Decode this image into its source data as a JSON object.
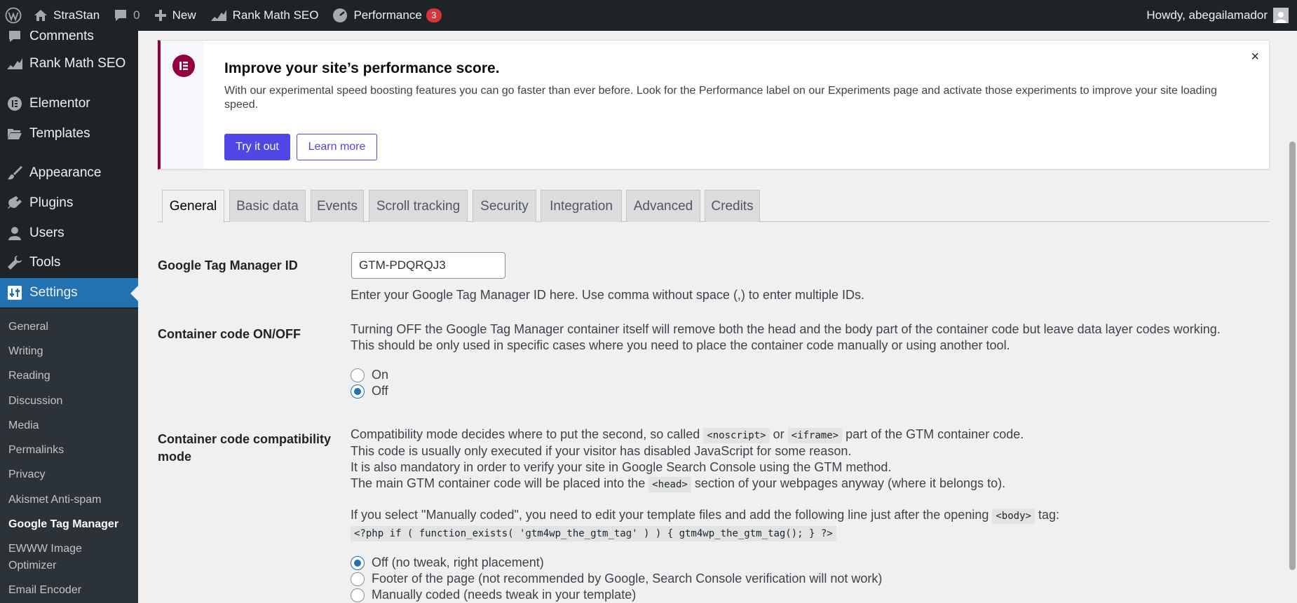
{
  "adminbar": {
    "site_name": "StraStan",
    "comments_count": "0",
    "new_label": "New",
    "rankmath_label": "Rank Math SEO",
    "performance_label": "Performance",
    "performance_badge": "3",
    "howdy": "Howdy, abegailamador"
  },
  "sidebar": {
    "items": [
      {
        "label": "Comments",
        "icon": "comment-icon"
      },
      {
        "label": "Rank Math SEO",
        "icon": "rankmath-icon"
      },
      {
        "label": "Elementor",
        "icon": "elementor-icon"
      },
      {
        "label": "Templates",
        "icon": "folder-icon"
      },
      {
        "label": "Appearance",
        "icon": "brush-icon"
      },
      {
        "label": "Plugins",
        "icon": "plug-icon"
      },
      {
        "label": "Users",
        "icon": "user-icon"
      },
      {
        "label": "Tools",
        "icon": "wrench-icon"
      },
      {
        "label": "Settings",
        "icon": "settings-icon"
      }
    ],
    "submenu": [
      "General",
      "Writing",
      "Reading",
      "Discussion",
      "Media",
      "Permalinks",
      "Privacy",
      "Akismet Anti-spam",
      "Google Tag Manager",
      "EWWW Image",
      "Optimizer",
      "Email Encoder"
    ]
  },
  "notice": {
    "title": "Improve your site’s performance score.",
    "text": "With our experimental speed boosting features you can go faster than ever before. Look for the Performance label on our Experiments page and activate those experiments to improve your site loading speed.",
    "primary_button": "Try it out",
    "secondary_button": "Learn more",
    "close": "×"
  },
  "tabs": [
    "General",
    "Basic data",
    "Events",
    "Scroll tracking",
    "Security",
    "Integration",
    "Advanced",
    "Credits"
  ],
  "form": {
    "gtm_id": {
      "label": "Google Tag Manager ID",
      "value": "GTM-PDQRQJ3",
      "help": "Enter your Google Tag Manager ID here. Use comma without space (,) to enter multiple IDs."
    },
    "container_onoff": {
      "label": "Container code ON/OFF",
      "desc1": "Turning OFF the Google Tag Manager container itself will remove both the head and the body part of the container code but leave data layer codes working.",
      "desc2": "This should be only used in specific cases where you need to place the container code manually or using another tool.",
      "options": [
        "On",
        "Off"
      ],
      "selected": "Off"
    },
    "compat_mode": {
      "label_line1": "Container code compatibility",
      "label_line2": "mode",
      "line1_pre": "Compatibility mode decides where to put the second, so called",
      "line1_code1": "<noscript>",
      "line1_or": "or",
      "line1_code2": "<iframe>",
      "line1_post": "part of the GTM container code.",
      "line2": "This code is usually only executed if your visitor has disabled JavaScript for some reason.",
      "line3": "It is also mandatory in order to verify your site in Google Search Console using the GTM method.",
      "line4_pre": "The main GTM container code will be placed into the",
      "line4_code": "<head>",
      "line4_post": "section of your webpages anyway (where it belongs to).",
      "line5_pre": "If you select \"Manually coded\", you need to edit your template files and add the following line just after the opening",
      "line5_code": "<body>",
      "line5_post": "tag:",
      "php_line": "<?php if ( function_exists( 'gtm4wp_the_gtm_tag' ) ) { gtm4wp_the_gtm_tag(); } ?>",
      "options": [
        "Off (no tweak, right placement)",
        "Footer of the page (not recommended by Google, Search Console verification will not work)",
        "Manually coded (needs tweak in your template)"
      ],
      "selected": "Off (no tweak, right placement)"
    }
  },
  "colors": {
    "adminbar_bg": "#1d2327",
    "active_menu": "#2271b1",
    "elementor_brand": "#93003f",
    "button_primary": "#5046e5"
  }
}
